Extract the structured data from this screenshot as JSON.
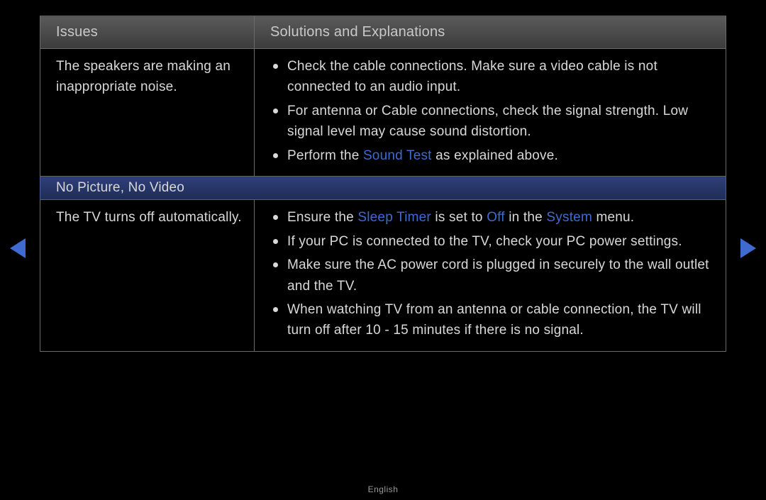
{
  "headers": {
    "issues": "Issues",
    "solutions": "Solutions and Explanations"
  },
  "rows": {
    "r1": {
      "issue": "The speakers are making an inappropriate noise.",
      "s1": "Check the cable connections. Make sure a video cable is not connected to an audio input.",
      "s2": "For antenna or Cable connections, check the signal strength. Low signal level may cause sound distortion.",
      "s3_pre": "Perform the ",
      "s3_kw": "Sound Test",
      "s3_post": " as explained above."
    },
    "section2": "No Picture, No Video",
    "r2": {
      "issue": "The TV turns off automatically.",
      "s1_a": "Ensure the ",
      "s1_kw1": "Sleep Timer",
      "s1_b": " is set to ",
      "s1_kw2": "Off",
      "s1_c": " in the ",
      "s1_kw3": "System",
      "s1_d": " menu.",
      "s2": "If your PC is connected to the TV, check your PC power settings.",
      "s3": "Make sure the AC power cord is plugged in securely to the wall outlet and the TV.",
      "s4": "When watching TV from an antenna or cable connection, the TV will turn off after 10 - 15 minutes if there is no signal."
    }
  },
  "footer": {
    "language": "English"
  }
}
